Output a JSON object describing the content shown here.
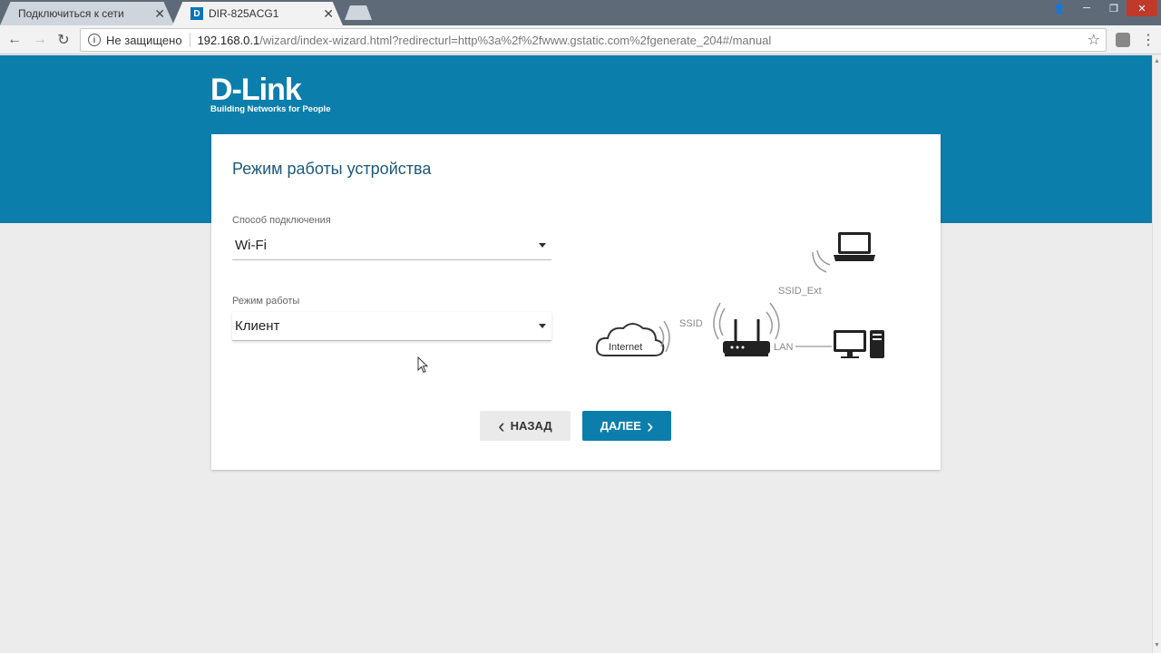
{
  "browser": {
    "tabs": [
      {
        "label": "Подключиться к сети",
        "active": false
      },
      {
        "label": "DIR-825ACG1",
        "active": true
      }
    ],
    "address": {
      "security_label": "Не защищено",
      "url_host": "192.168.0.1",
      "url_path": "/wizard/index-wizard.html?redirecturl=http%3a%2f%2fwww.gstatic.com%2fgenerate_204#/manual"
    }
  },
  "page": {
    "brand": {
      "name": "D-Link",
      "tagline": "Building Networks for People"
    },
    "title": "Режим работы устройства",
    "connection": {
      "label": "Способ подключения",
      "value": "Wi-Fi"
    },
    "mode": {
      "label": "Режим работы",
      "value": "Клиент"
    },
    "buttons": {
      "back": "НАЗАД",
      "next": "ДАЛЕЕ"
    },
    "diagram": {
      "internet": "Internet",
      "ssid": "SSID",
      "ssid_ext": "SSID_Ext",
      "lan": "LAN"
    }
  },
  "colors": {
    "brand_blue": "#0c7eac",
    "title_blue": "#1d5a7a"
  }
}
